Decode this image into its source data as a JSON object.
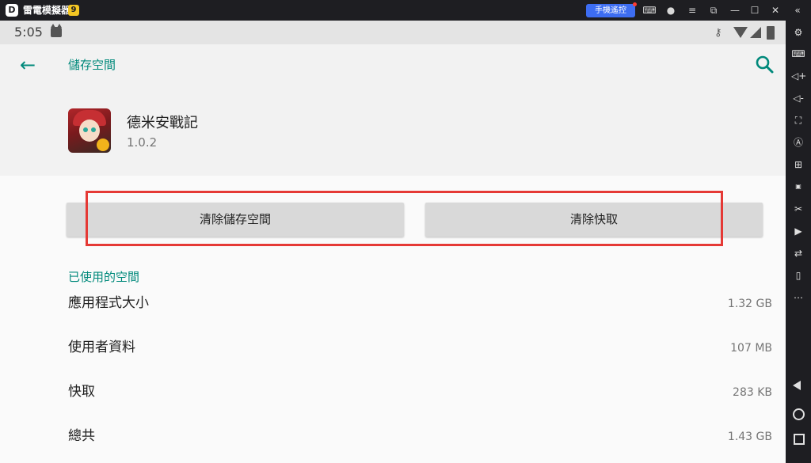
{
  "window": {
    "app_name": "雷電模擬器",
    "vip_badge": "9",
    "remote_control_label": "手機遙控",
    "icons": [
      "gamepad-icon",
      "user-icon",
      "menu-icon",
      "restore-icon",
      "minimize-icon",
      "maximize-icon",
      "close-icon",
      "collapse-icon"
    ]
  },
  "status_bar": {
    "time": "5:05"
  },
  "toolbar": {
    "title": "儲存空間"
  },
  "app_info": {
    "name": "德米安戰記",
    "version": "1.0.2"
  },
  "buttons": {
    "clear_storage": "清除儲存空間",
    "clear_cache": "清除快取"
  },
  "storage": {
    "section_title": "已使用的空間",
    "rows": [
      {
        "label": "應用程式大小",
        "value": "1.32 GB"
      },
      {
        "label": "使用者資料",
        "value": "107 MB"
      },
      {
        "label": "快取",
        "value": "283 KB"
      },
      {
        "label": "總共",
        "value": "1.43 GB"
      }
    ]
  },
  "sidebar": {
    "icons": [
      "settings-icon",
      "keyboard-icon",
      "volume-up-icon",
      "volume-down-icon",
      "screenshot-icon",
      "auto-click-icon",
      "add-window-icon",
      "apk-install-icon",
      "scissors-icon",
      "record-icon",
      "sync-icon",
      "shake-icon",
      "more-icon",
      "nav-back-icon",
      "nav-home-icon",
      "nav-recent-icon"
    ]
  },
  "colors": {
    "accent": "#00897b",
    "highlight_box": "#e53935",
    "remote_button": "#3d6df2"
  }
}
